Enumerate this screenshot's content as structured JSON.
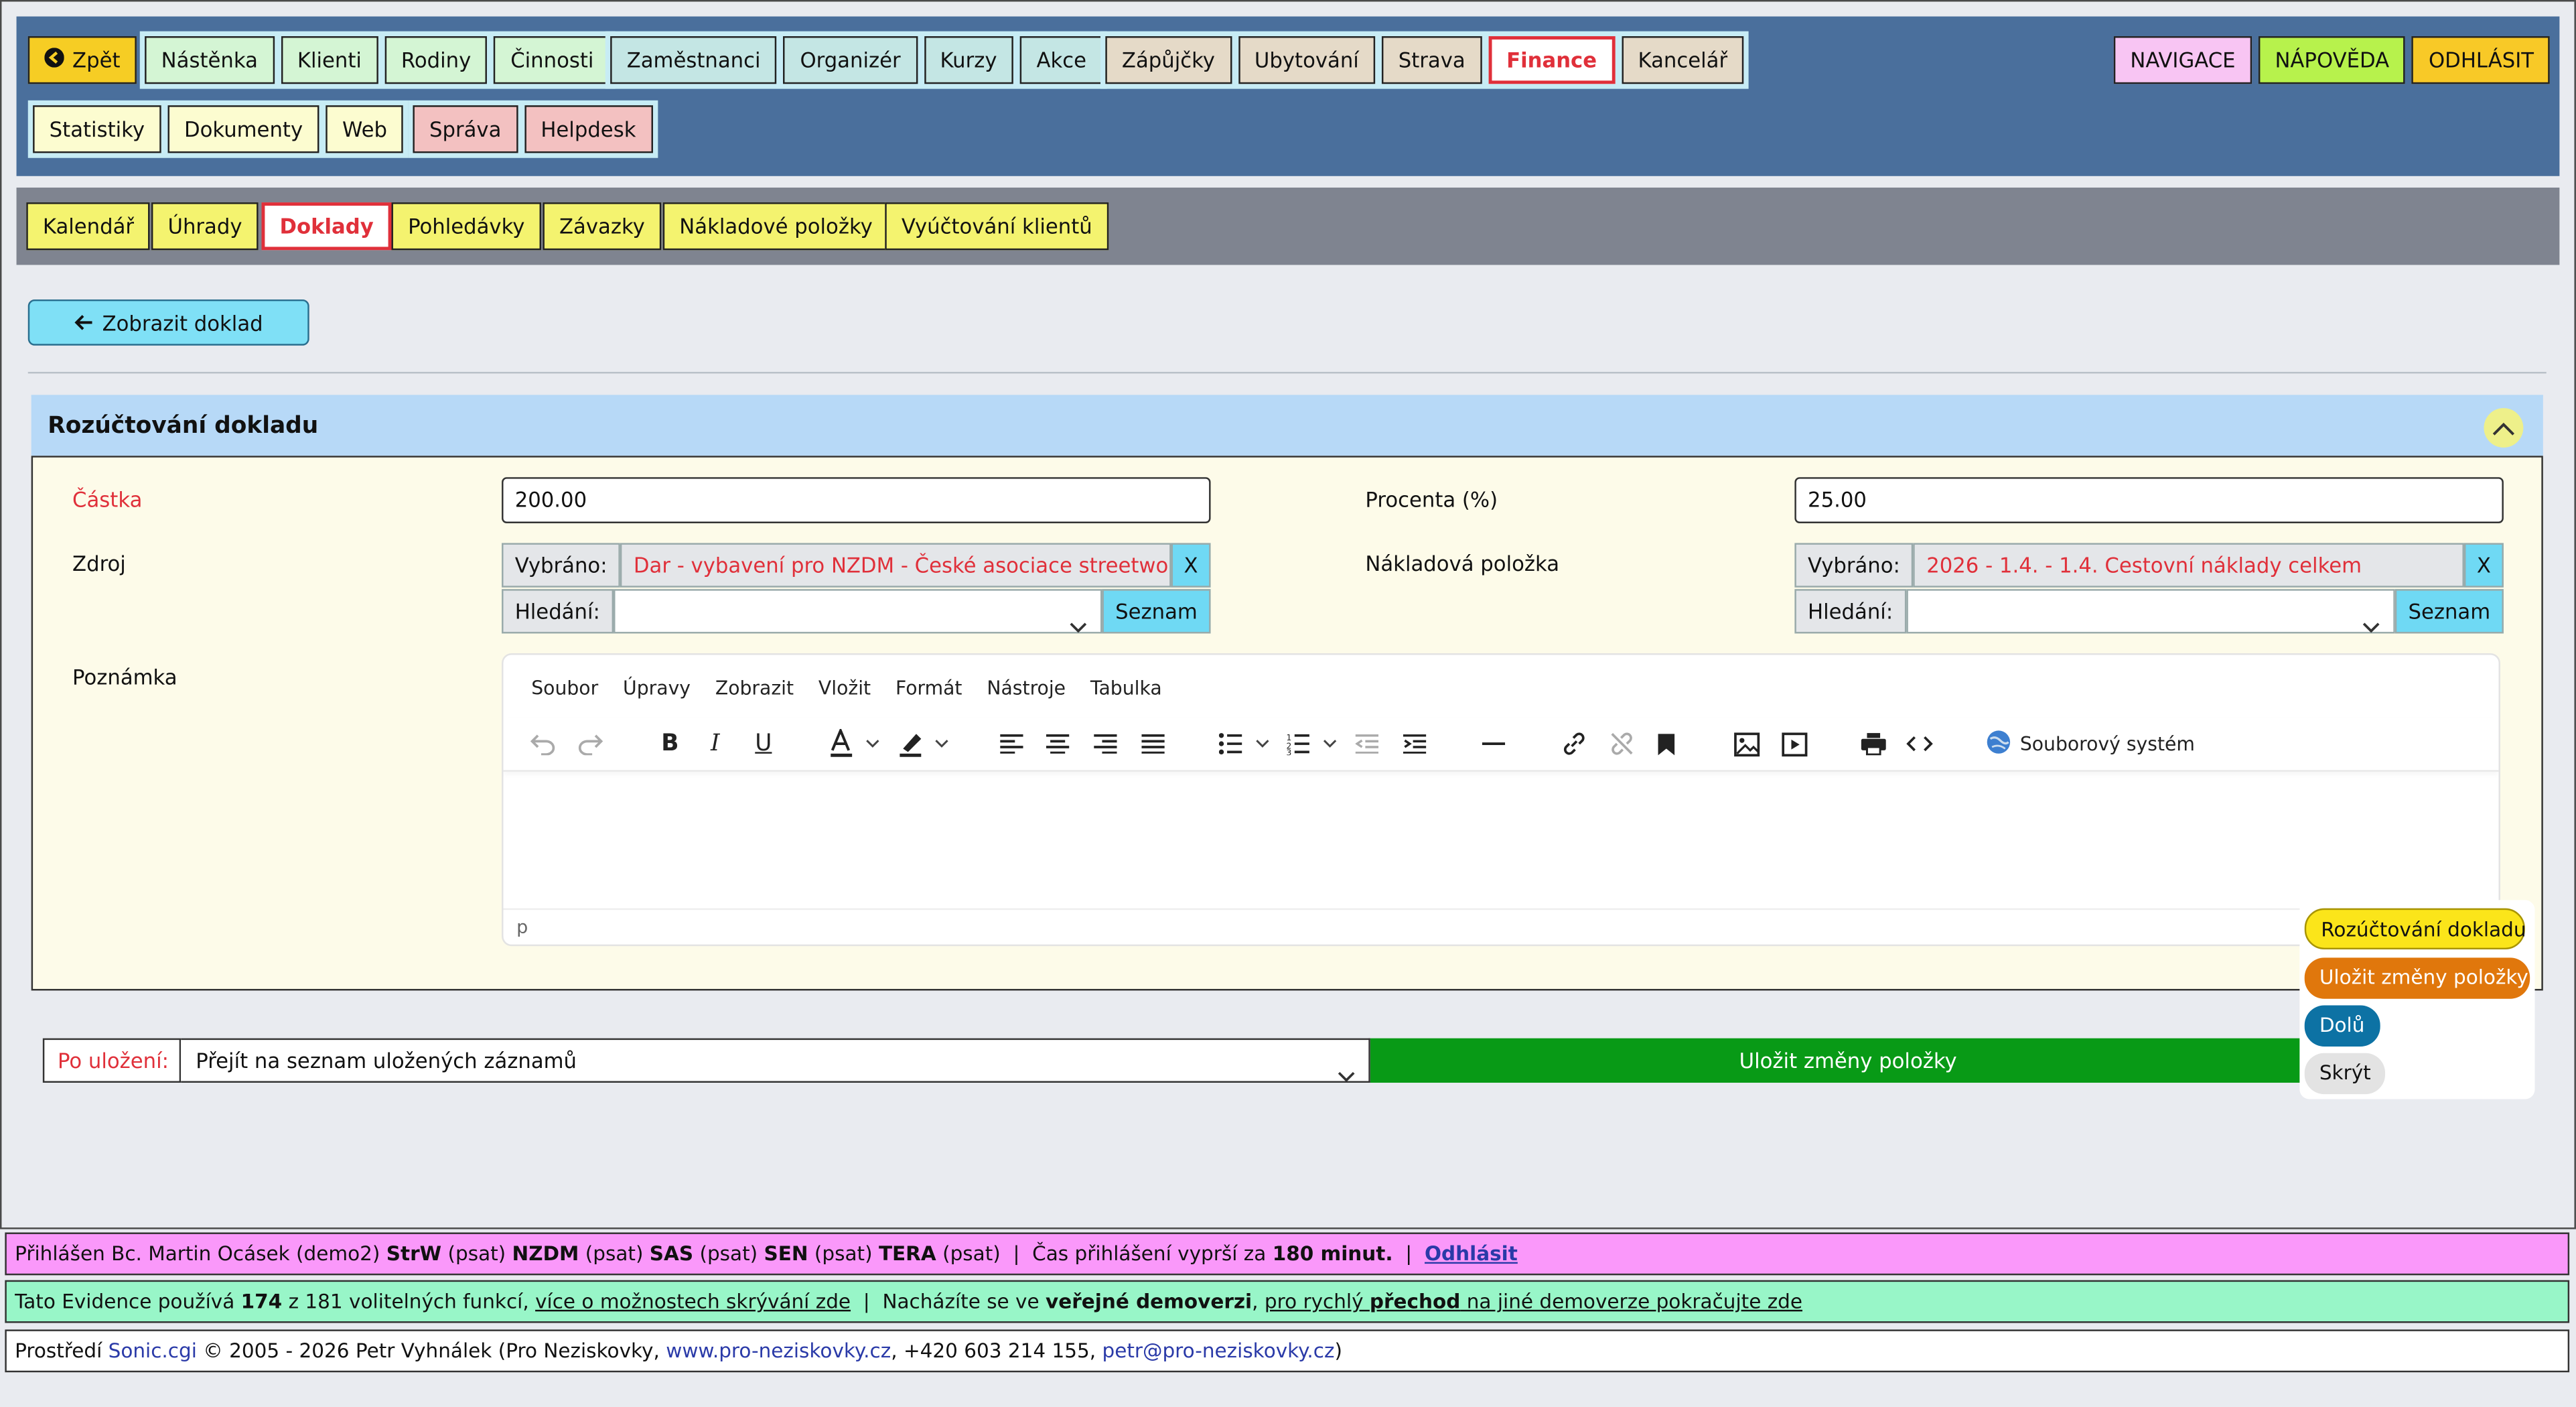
{
  "nav": {
    "back": "Zpět",
    "group1": [
      "Nástěnka",
      "Klienti",
      "Rodiny",
      "Činnosti"
    ],
    "group2": [
      "Zaměstnanci",
      "Organizér",
      "Kurzy",
      "Akce"
    ],
    "group3": [
      "Zápůjčky",
      "Ubytování",
      "Strava",
      "Finance",
      "Kancelář"
    ],
    "group4": [
      "Statistiky",
      "Dokumenty",
      "Web"
    ],
    "group5": [
      "Správa",
      "Helpdesk"
    ],
    "right": [
      "NAVIGACE",
      "NÁPOVĚDA",
      "ODHLÁSIT"
    ]
  },
  "subnav": [
    "Kalendář",
    "Úhrady",
    "Doklady",
    "Pohledávky",
    "Závazky",
    "Nákladové položky",
    "Vyúčtování klientů"
  ],
  "back_button": "Zobrazit doklad",
  "panel": {
    "title": "Rozúčtování dokladu",
    "amount_label": "Částka",
    "amount_value": "200.00",
    "percent_label": "Procenta (%)",
    "percent_value": "25.00",
    "source_label": "Zdroj",
    "source_selected_prefix": "Vybráno:",
    "source_selected": "Dar - vybavení pro NZDM - České asociace streetwork",
    "cost_label": "Nákladová položka",
    "cost_selected_prefix": "Vybráno:",
    "cost_selected": "2026 - 1.4. - 1.4. Cestovní náklady celkem",
    "clear_label": "X",
    "search_prefix": "Hledání:",
    "list_label": "Seznam",
    "note_label": "Poznámka"
  },
  "editor": {
    "menu": [
      "Soubor",
      "Úpravy",
      "Zobrazit",
      "Vložit",
      "Formát",
      "Nástroje",
      "Tabulka"
    ],
    "file_system": "Souborový systém",
    "status_path": "p"
  },
  "save_row": {
    "after_label": "Po uložení:",
    "after_value": "Přejít na seznam uložených záznamů",
    "save_label": "Uložit změny položky"
  },
  "float_panel": {
    "b1": "Rozúčtování dokladu",
    "b2": "Uložit změny položky",
    "b3": "Dolů",
    "b4": "Skrýt"
  },
  "footer": {
    "l1_a": "Přihlášen Bc. Martin Ocásek (demo2) ",
    "l1_strw": "StrW",
    "l1_p1": " (psat) ",
    "l1_nzdm": "NZDM",
    "l1_p2": " (psat) ",
    "l1_sas": "SAS",
    "l1_p3": " (psat) ",
    "l1_sen": "SEN",
    "l1_p4": " (psat) ",
    "l1_tera": "TERA",
    "l1_p5": " (psat)  |  Čas přihlášení vyprší za ",
    "l1_minutes": "180 minut.",
    "l1_sep": "  |  ",
    "l1_logout": "Odhlásit",
    "l2_a": "Tato Evidence používá ",
    "l2_count": "174",
    "l2_b": " z 181 volitelných funkcí, ",
    "l2_link1": "více o možnostech skrývání zde",
    "l2_c": "  |  Nacházíte se ve ",
    "l2_demo": "veřejné demoverzi",
    "l2_d": ", ",
    "l2_link2a": "pro rychlý ",
    "l2_link2b": "přechod",
    "l2_link2c": " na jiné demoverze pokračujte zde",
    "l3_a": "Prostředí ",
    "l3_sonic": "Sonic.cgi",
    "l3_b": " © 2005 - 2026 Petr Vyhnálek (Pro Neziskovky, ",
    "l3_web": "www.pro-neziskovky.cz",
    "l3_c": ", +420 603 214 155, ",
    "l3_mail": "petr@pro-neziskovky.cz",
    "l3_d": ")"
  }
}
